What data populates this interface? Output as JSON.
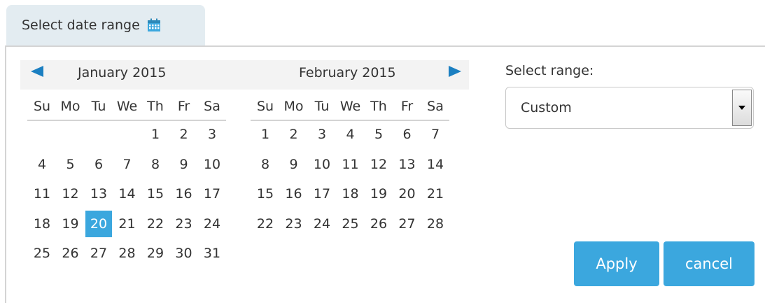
{
  "trigger": {
    "label": "Select date range",
    "icon": "calendar-icon"
  },
  "calendar": {
    "weekday_headers": [
      "Su",
      "Mo",
      "Tu",
      "We",
      "Th",
      "Fr",
      "Sa"
    ],
    "months": [
      {
        "title": "January 2015",
        "first_weekday": 4,
        "days": [
          "1",
          "2",
          "3",
          "4",
          "5",
          "6",
          "7",
          "8",
          "9",
          "10",
          "11",
          "12",
          "13",
          "14",
          "15",
          "16",
          "17",
          "18",
          "19",
          "20",
          "21",
          "22",
          "23",
          "24",
          "25",
          "26",
          "27",
          "28",
          "29",
          "30",
          "31"
        ]
      },
      {
        "title": "February 2015",
        "first_weekday": 0,
        "days": [
          "1",
          "2",
          "3",
          "4",
          "5",
          "6",
          "7",
          "8",
          "9",
          "10",
          "11",
          "12",
          "13",
          "14",
          "15",
          "16",
          "17",
          "18",
          "19",
          "20",
          "21",
          "22",
          "23",
          "24",
          "25",
          "26",
          "27",
          "28"
        ]
      }
    ],
    "selected": {
      "month": 0,
      "day": "20"
    },
    "prev_icon": "arrow-left-icon",
    "next_icon": "arrow-right-icon"
  },
  "range": {
    "label": "Select range:",
    "value": "Custom",
    "dropdown_icon": "chevron-down-icon"
  },
  "buttons": {
    "apply": "Apply",
    "cancel": "cancel"
  },
  "colors": {
    "accent": "#3ba7de",
    "trigger_bg": "#e3ecf1",
    "header_bg": "#f3f3f3"
  }
}
